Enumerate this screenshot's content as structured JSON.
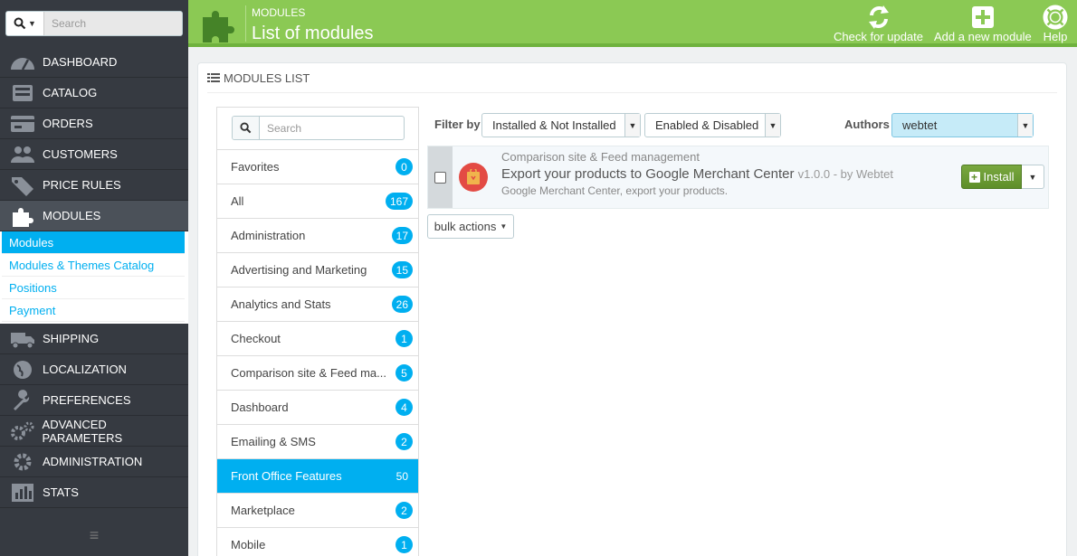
{
  "sidebar": {
    "search_placeholder": "Search",
    "items": [
      {
        "label": "DASHBOARD",
        "icon": "dashboard-icon"
      },
      {
        "label": "CATALOG",
        "icon": "catalog-icon"
      },
      {
        "label": "ORDERS",
        "icon": "orders-icon"
      },
      {
        "label": "CUSTOMERS",
        "icon": "customers-icon"
      },
      {
        "label": "PRICE RULES",
        "icon": "price-rules-icon"
      },
      {
        "label": "MODULES",
        "icon": "modules-icon"
      },
      {
        "label": "SHIPPING",
        "icon": "shipping-icon"
      },
      {
        "label": "LOCALIZATION",
        "icon": "localization-icon"
      },
      {
        "label": "PREFERENCES",
        "icon": "preferences-icon"
      },
      {
        "label": "ADVANCED PARAMETERS",
        "icon": "advanced-parameters-icon"
      },
      {
        "label": "ADMINISTRATION",
        "icon": "administration-icon"
      },
      {
        "label": "STATS",
        "icon": "stats-icon"
      }
    ],
    "subitems": [
      {
        "label": "Modules"
      },
      {
        "label": "Modules & Themes Catalog"
      },
      {
        "label": "Positions"
      },
      {
        "label": "Payment"
      }
    ]
  },
  "header": {
    "breadcrumb": "MODULES",
    "title": "List of modules",
    "check_update": "Check for update",
    "add_module": "Add a new module",
    "help": "Help",
    "color": "#8bc954"
  },
  "panel": {
    "title": "MODULES LIST"
  },
  "categories": {
    "search_placeholder": "Search",
    "items": [
      {
        "label": "Favorites",
        "count": "0"
      },
      {
        "label": "All",
        "count": "167"
      },
      {
        "label": "Administration",
        "count": "17"
      },
      {
        "label": "Advertising and Marketing",
        "count": "15"
      },
      {
        "label": "Analytics and Stats",
        "count": "26"
      },
      {
        "label": "Checkout",
        "count": "1"
      },
      {
        "label": "Comparison site & Feed ma...",
        "count": "5"
      },
      {
        "label": "Dashboard",
        "count": "4"
      },
      {
        "label": "Emailing & SMS",
        "count": "2"
      },
      {
        "label": "Front Office Features",
        "count": "50"
      },
      {
        "label": "Marketplace",
        "count": "2"
      },
      {
        "label": "Mobile",
        "count": "1"
      }
    ]
  },
  "filters": {
    "filter_by": "Filter by",
    "install_state": "Installed & Not Installed",
    "enable_state": "Enabled & Disabled",
    "authors_label": "Authors",
    "author_value": "webtet"
  },
  "module": {
    "category": "Comparison site & Feed management",
    "name": "Export your products to Google Merchant Center",
    "version": "v1.0.0 - by Webtet",
    "description": "Google Merchant Center, export your products.",
    "install_label": "Install"
  },
  "bulk_actions": "bulk actions"
}
